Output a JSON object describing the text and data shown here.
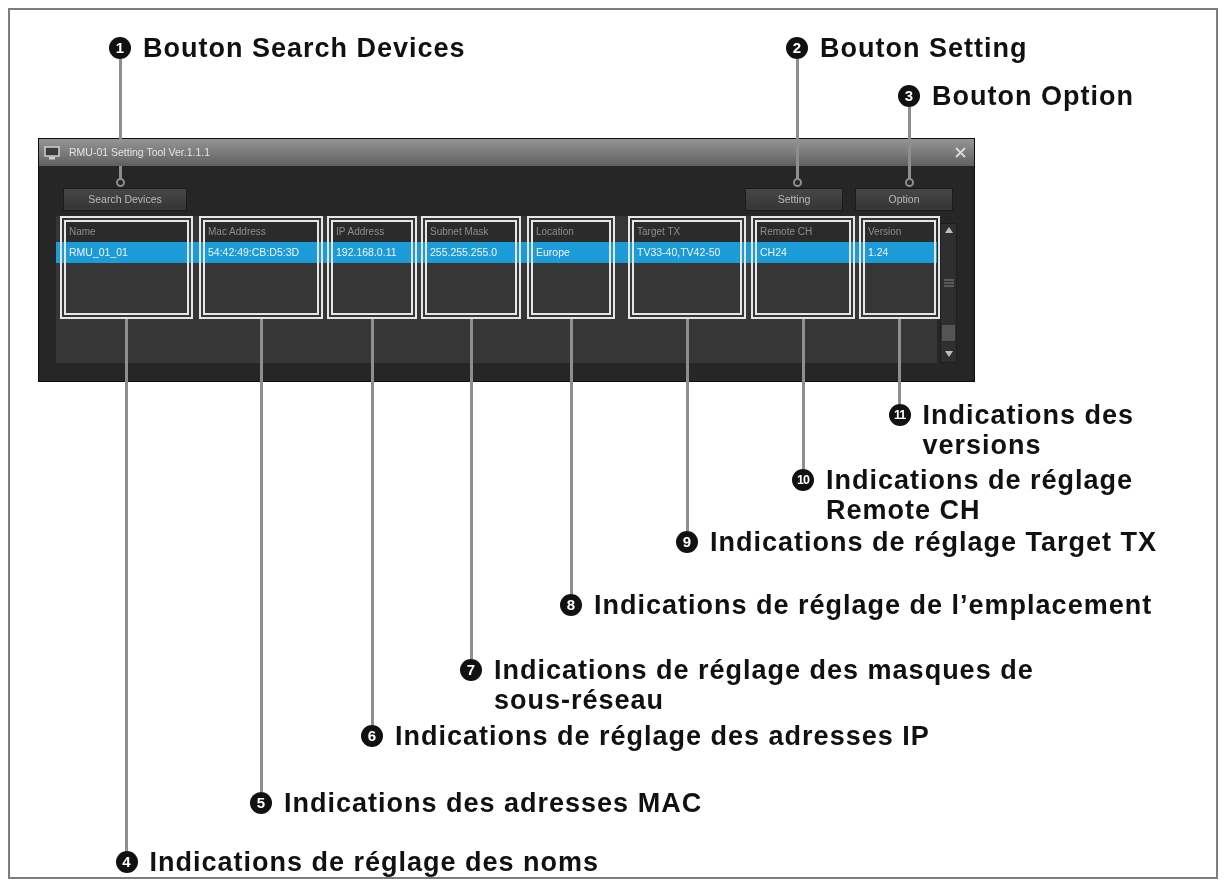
{
  "window": {
    "title": "RMU-01 Setting Tool Ver.1.1.1"
  },
  "callouts": [
    {
      "number": "1",
      "text": "Bouton Search Devices"
    },
    {
      "number": "2",
      "text": "Bouton Setting"
    },
    {
      "number": "3",
      "text": "Bouton Option"
    }
  ],
  "buttons": [
    {
      "label": "Search Devices"
    },
    {
      "label": "Setting"
    },
    {
      "label": "Option"
    }
  ],
  "table": {
    "columns": [
      "Name",
      "Mac Address",
      "IP Address",
      "Subnet Mask",
      "Location",
      "Target TX",
      "Remote CH",
      "Version"
    ],
    "rows": [
      {
        "selected": true,
        "cells": [
          "RMU_01_01",
          "54:42:49:CB:D5:3D",
          "192.168.0.11",
          "255.255.255.0",
          "Europe",
          "TV33-40,TV42-50",
          "CH24",
          "1.24"
        ]
      }
    ]
  },
  "column_callouts": [
    {
      "number": "11",
      "text": "Indications des versions"
    },
    {
      "number": "10",
      "text": "Indications de réglage Remote CH"
    },
    {
      "number": "9",
      "text": "Indications de réglage Target TX"
    },
    {
      "number": "8",
      "text": "Indications de réglage de l’emplacement"
    },
    {
      "number": "7",
      "text": "Indications de réglage des masques de sous-réseau"
    },
    {
      "number": "6",
      "text": "Indications de réglage des adresses IP"
    },
    {
      "number": "5",
      "text": "Indications des adresses MAC"
    },
    {
      "number": "4",
      "text": "Indications de réglage des noms"
    }
  ]
}
